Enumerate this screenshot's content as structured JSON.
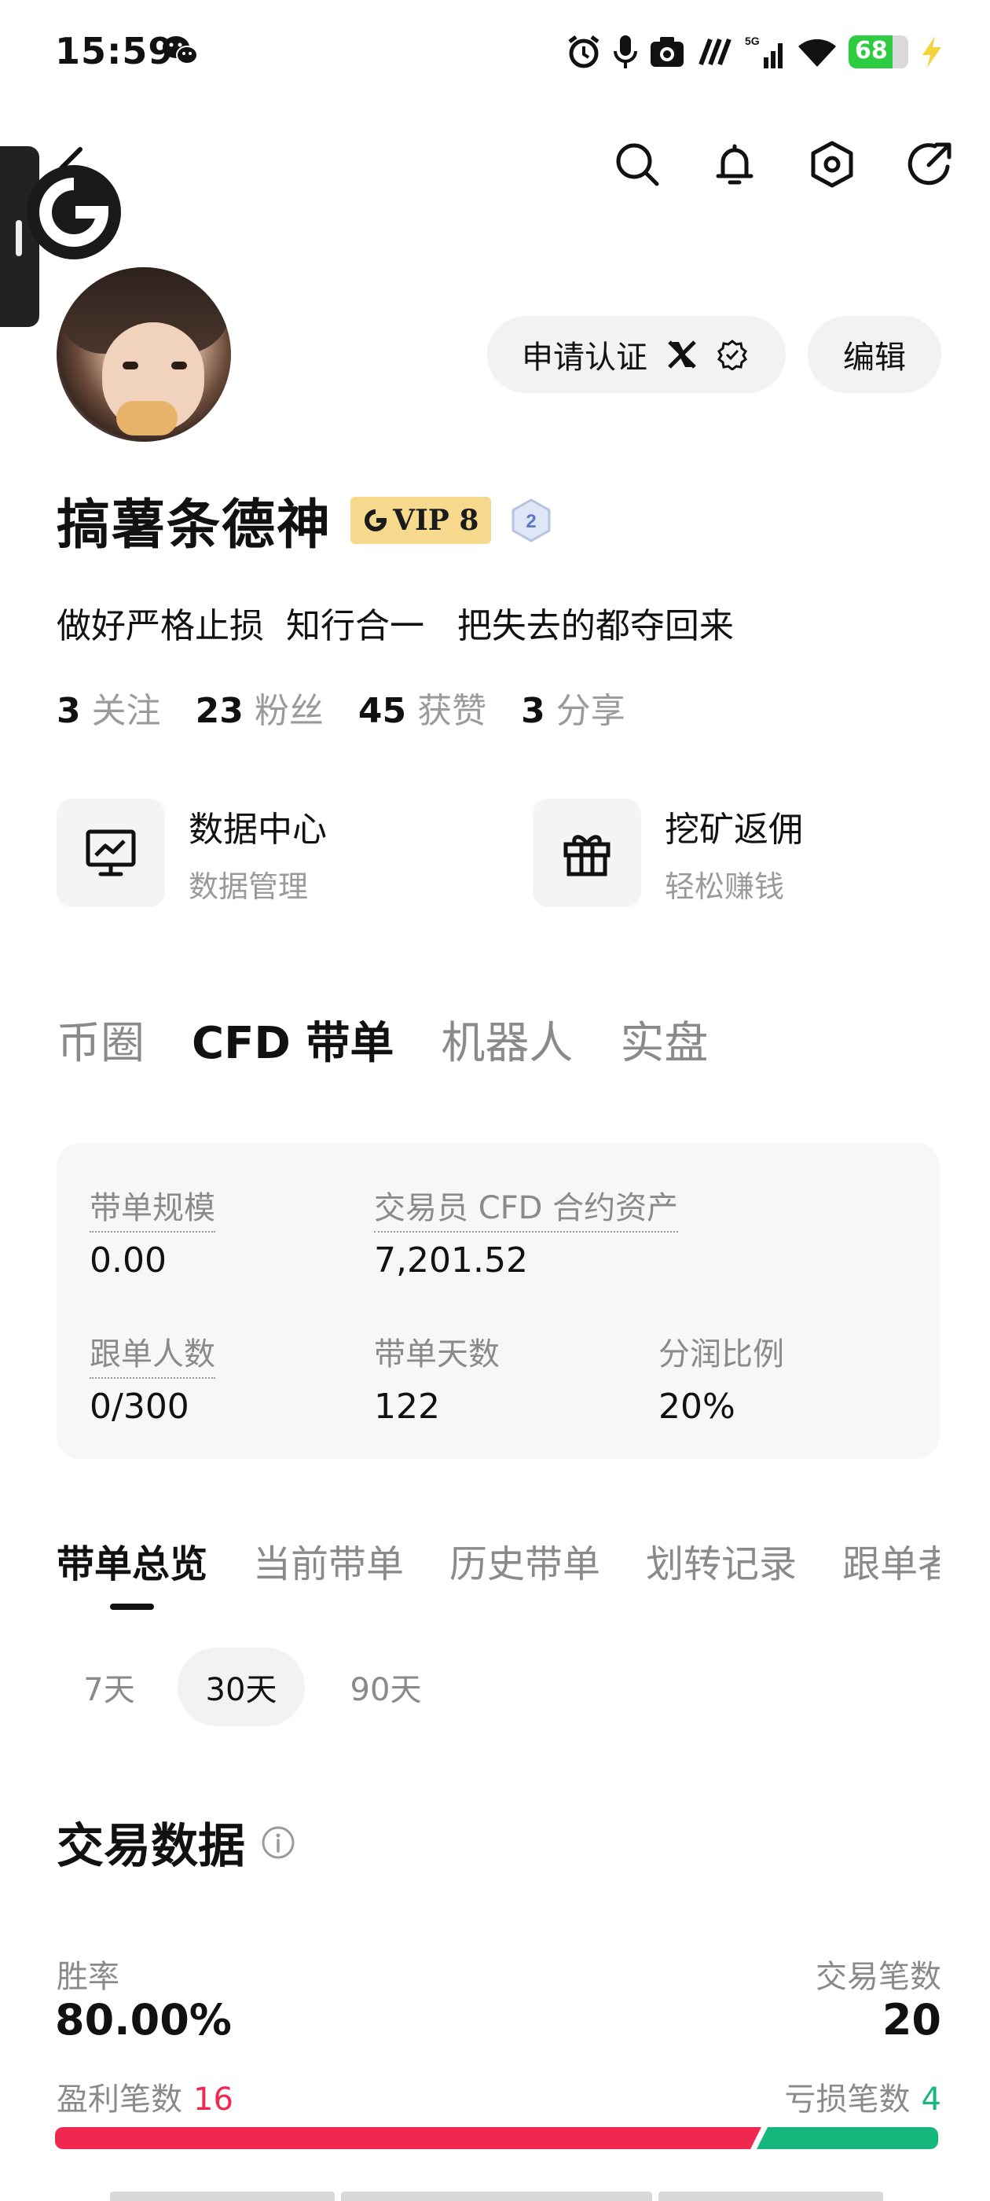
{
  "status_bar": {
    "time": "15:59",
    "battery": "68",
    "network": "5G",
    "icons": [
      "wechat-icon",
      "alarm-icon",
      "mic-icon",
      "camera-icon",
      "nfc-icon",
      "signal-icon",
      "wifi-icon",
      "battery-icon",
      "charging-icon"
    ]
  },
  "header": {
    "icons": [
      "back-icon",
      "search-icon",
      "bell-icon",
      "settings-icon",
      "share-icon"
    ]
  },
  "profile": {
    "verify_label": "申请认证",
    "edit_label": "编辑",
    "name": "搞薯条德神",
    "vip_label": "VIP 8",
    "level": "2",
    "bio": "做好严格止损  知行合一   把失去的都夺回来",
    "stats": [
      {
        "value": "3",
        "label": "关注"
      },
      {
        "value": "23",
        "label": "粉丝"
      },
      {
        "value": "45",
        "label": "获赞"
      },
      {
        "value": "3",
        "label": "分享"
      }
    ]
  },
  "quick_entries": [
    {
      "title": "数据中心",
      "subtitle": "数据管理",
      "icon": "chart-monitor-icon"
    },
    {
      "title": "挖矿返佣",
      "subtitle": "轻松赚钱",
      "icon": "gift-icon"
    }
  ],
  "main_tabs": [
    "币圈",
    "CFD 带单",
    "机器人",
    "实盘"
  ],
  "main_tab_active": "CFD 带单",
  "summary": {
    "scale_label": "带单规模",
    "scale_value": "0.00",
    "assets_label": "交易员 CFD 合约资产",
    "assets_value": "7,201.52",
    "followers_label": "跟单人数",
    "followers_value": "0/300",
    "days_label": "带单天数",
    "days_value": "122",
    "share_label": "分润比例",
    "share_value": "20%"
  },
  "sub_tabs": [
    "带单总览",
    "当前带单",
    "历史带单",
    "划转记录",
    "跟单者"
  ],
  "periods": [
    "7天",
    "30天",
    "90天"
  ],
  "period_active": "30天",
  "trade_data": {
    "title": "交易数据",
    "win_rate_label": "胜率",
    "win_rate": "80.00%",
    "trades_label": "交易笔数",
    "trades": "20",
    "profit_label": "盈利笔数",
    "profit_count": "16",
    "loss_label": "亏损笔数",
    "loss_count": "4",
    "win_fraction": 0.8,
    "colors": {
      "profit": "#f0284d",
      "loss": "#16b77a"
    }
  }
}
